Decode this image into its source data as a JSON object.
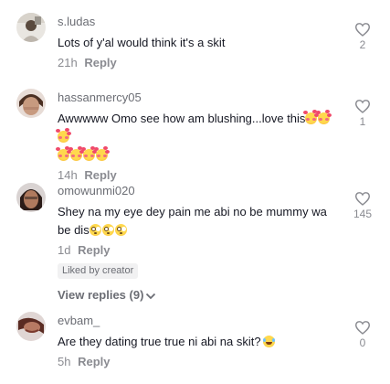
{
  "comments": [
    {
      "username": "s.ludas",
      "text": "Lots of y'al would think it's a skit",
      "emojis": [],
      "time": "21h",
      "reply_label": "Reply",
      "likes": "2"
    },
    {
      "username": "hassanmercy05",
      "text": "Awwwww Omo see how am blushing...love this",
      "emojis": [
        "smiling-face-with-hearts-emoji",
        "smiling-face-with-hearts-emoji",
        "smiling-face-with-hearts-emoji",
        "smiling-face-with-hearts-emoji",
        "smiling-face-with-hearts-emoji",
        "smiling-face-with-hearts-emoji",
        "smiling-face-with-hearts-emoji"
      ],
      "time": "14h",
      "reply_label": "Reply",
      "likes": "1"
    },
    {
      "username": "omowunmi020",
      "text": "Shey na my eye dey pain me abi no be mummy wa be dis",
      "emojis": [
        "flushed-face-emoji",
        "flushed-face-emoji",
        "flushed-face-emoji"
      ],
      "time": "1d",
      "reply_label": "Reply",
      "badge": "Liked by creator",
      "view_replies": "View replies (9)",
      "likes": "145"
    },
    {
      "username": "evbam_",
      "text": "Are they dating true true ni abi na skit?",
      "emojis": [
        "laughing-face-emoji"
      ],
      "time": "5h",
      "reply_label": "Reply",
      "likes": "0"
    }
  ],
  "colors": {
    "text": "#161823",
    "muted": "#8a8b91",
    "username": "#6b6d74",
    "badge_bg": "#f1f1f2"
  }
}
